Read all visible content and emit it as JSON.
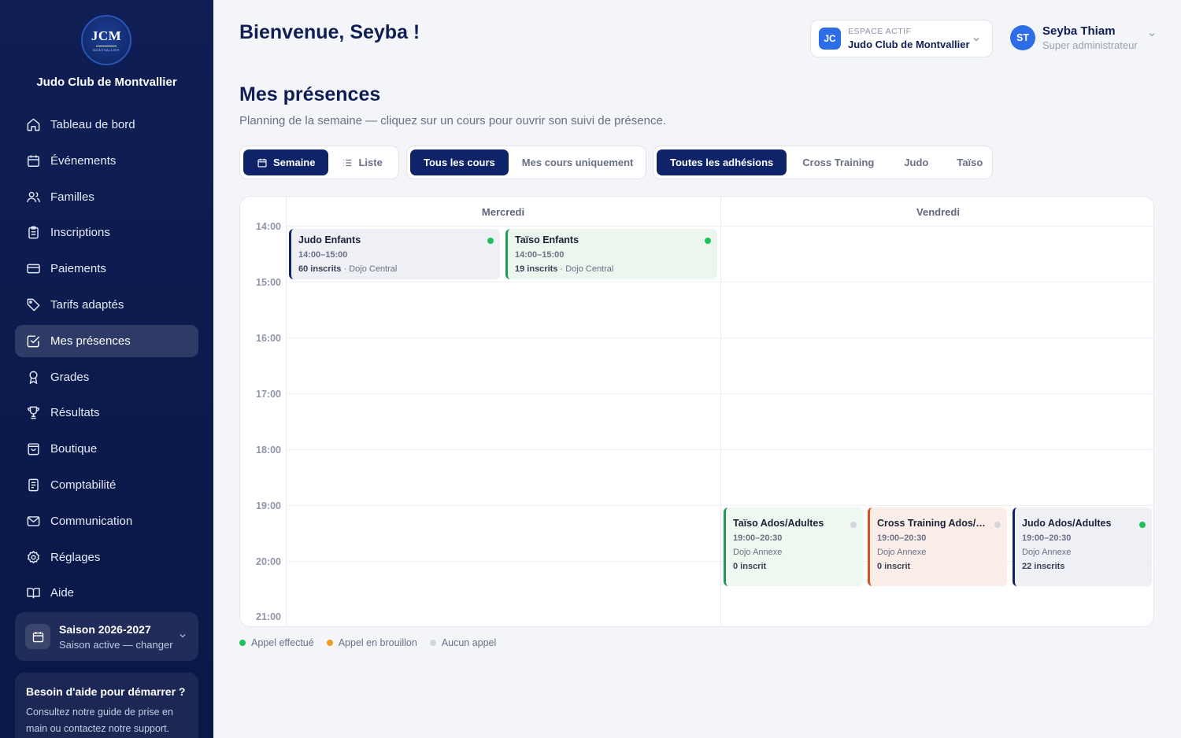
{
  "sidebar": {
    "logo_text": "JCM",
    "logo_sub": "MONTVALLIER",
    "club_name": "Judo Club de Montvallier",
    "items": [
      {
        "label": "Tableau de bord",
        "icon": "home-icon"
      },
      {
        "label": "Événements",
        "icon": "calendar-icon"
      },
      {
        "label": "Familles",
        "icon": "users-icon"
      },
      {
        "label": "Inscriptions",
        "icon": "clipboard-icon"
      },
      {
        "label": "Paiements",
        "icon": "credit-card-icon"
      },
      {
        "label": "Tarifs adaptés",
        "icon": "tag-icon"
      },
      {
        "label": "Mes présences",
        "icon": "check-square-icon",
        "active": true
      },
      {
        "label": "Grades",
        "icon": "award-icon"
      },
      {
        "label": "Résultats",
        "icon": "trophy-icon"
      },
      {
        "label": "Boutique",
        "icon": "shopping-bag-icon"
      },
      {
        "label": "Comptabilité",
        "icon": "ledger-icon"
      },
      {
        "label": "Communication",
        "icon": "mail-icon"
      },
      {
        "label": "Réglages",
        "icon": "gear-icon"
      },
      {
        "label": "Aide",
        "icon": "book-icon"
      }
    ],
    "season": {
      "title": "Saison 2026-2027",
      "subtitle": "Saison active — changer"
    },
    "help": {
      "title": "Besoin d'aide pour démarrer ?",
      "text": "Consultez notre guide de prise en main ou contactez notre support."
    }
  },
  "header": {
    "welcome": "Bienvenue, Seyba !",
    "space": {
      "badge": "JC",
      "label": "ESPACE ACTIF",
      "name": "Judo Club de Montvallier"
    },
    "user": {
      "initials": "ST",
      "name": "Seyba Thiam",
      "role": "Super administrateur"
    }
  },
  "page": {
    "title": "Mes présences",
    "subtitle": "Planning de la semaine — cliquez sur un cours pour ouvrir son suivi de présence."
  },
  "filters": {
    "view": [
      {
        "label": "Semaine",
        "active": true
      },
      {
        "label": "Liste",
        "active": false
      }
    ],
    "scope": [
      {
        "label": "Tous les cours",
        "active": true
      },
      {
        "label": "Mes cours uniquement",
        "active": false
      }
    ],
    "membership": [
      {
        "label": "Toutes les adhésions",
        "active": true
      },
      {
        "label": "Cross Training",
        "active": false
      },
      {
        "label": "Judo",
        "active": false
      },
      {
        "label": "Taïso",
        "active": false
      }
    ]
  },
  "calendar": {
    "days": [
      "Mercredi",
      "Vendredi"
    ],
    "hours": [
      "14:00",
      "15:00",
      "16:00",
      "17:00",
      "18:00",
      "19:00",
      "20:00",
      "21:00"
    ],
    "events": [
      {
        "title": "Judo Enfants",
        "time": "14:00–15:00",
        "count": "60 inscrits",
        "place": "Dojo Central",
        "status": "done",
        "accent": "#0f2468",
        "bg": "#eef0f6"
      },
      {
        "title": "Taïso Enfants",
        "time": "14:00–15:00",
        "count": "19 inscrits",
        "place": "Dojo Central",
        "status": "done",
        "accent": "#1e9a52",
        "bg": "#eaf6ee"
      },
      {
        "title": "Taïso Ados/Adultes",
        "time": "19:00–20:30",
        "place": "Dojo Annexe",
        "count": "0 inscrit",
        "status": "none",
        "accent": "#1e9a52",
        "bg": "#eef7f0"
      },
      {
        "title": "Cross Training Ados/Adultes",
        "time": "19:00–20:30",
        "place": "Dojo Annexe",
        "count": "0 inscrit",
        "status": "none",
        "accent": "#d4531f",
        "bg": "#fbeee9"
      },
      {
        "title": "Judo Ados/Adultes",
        "time": "19:00–20:30",
        "place": "Dojo Annexe",
        "count": "22 inscrits",
        "status": "done",
        "accent": "#0f2468",
        "bg": "#eef0f6"
      }
    ]
  },
  "legend": [
    {
      "label": "Appel effectué",
      "color": "#1fbf5a"
    },
    {
      "label": "Appel en brouillon",
      "color": "#f29a1f"
    },
    {
      "label": "Aucun appel",
      "color": "#d3d6de"
    }
  ],
  "colors": {
    "done": "#1fbf5a",
    "draft": "#f29a1f",
    "none": "#d3d6de",
    "primary": "#0f2468"
  }
}
